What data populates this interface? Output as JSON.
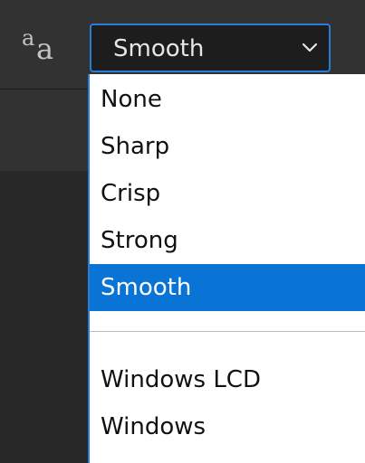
{
  "toolbar": {
    "anti_alias_icon": {
      "name": "text-anti-alias-icon",
      "small_glyph": "a",
      "large_glyph": "a"
    },
    "dropdown": {
      "selected_value": "Smooth",
      "chevron_icon": "chevron-down-icon"
    }
  },
  "menu": {
    "options": [
      {
        "label": "None",
        "selected": false
      },
      {
        "label": "Sharp",
        "selected": false
      },
      {
        "label": "Crisp",
        "selected": false
      },
      {
        "label": "Strong",
        "selected": false
      },
      {
        "label": "Smooth",
        "selected": true
      },
      {
        "label": "",
        "selected": false
      },
      {
        "label": "Windows LCD",
        "selected": false
      },
      {
        "label": "Windows",
        "selected": false
      }
    ]
  },
  "colors": {
    "accent": "#2a7dd6",
    "selected_background": "#0a74d6",
    "toolbar_background": "#323232",
    "menu_background": "#ffffff"
  }
}
